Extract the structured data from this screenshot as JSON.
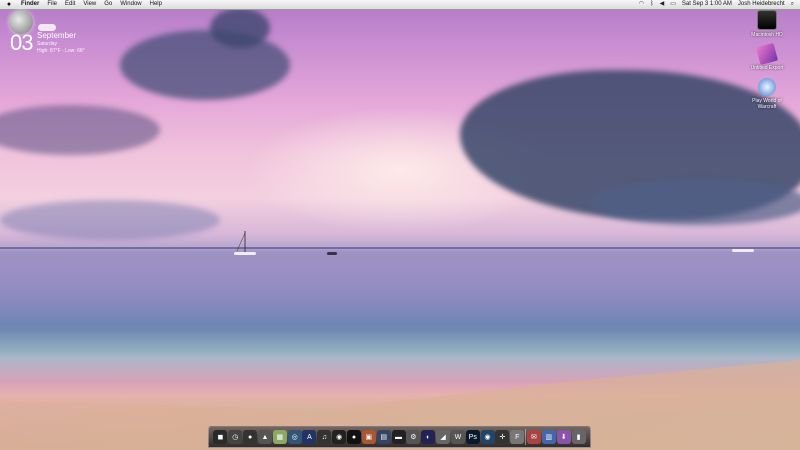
{
  "menubar": {
    "apple_icon": "apple-icon",
    "items": [
      {
        "label": "Finder",
        "bold": true
      },
      {
        "label": "File"
      },
      {
        "label": "Edit"
      },
      {
        "label": "View"
      },
      {
        "label": "Go"
      },
      {
        "label": "Window"
      },
      {
        "label": "Help"
      }
    ],
    "clock": "Sat Sep 3  1:00 AM",
    "user": "Josh Heidebrecht"
  },
  "weather": {
    "day": "03",
    "month": "September",
    "weekday": "Saturday",
    "hilo": "High: 87°F - Low: 68°"
  },
  "desktop_icons": [
    {
      "label": "Macintosh HD",
      "icon": "hard-drive-icon"
    },
    {
      "label": "Untitled Export",
      "icon": "export-icon"
    },
    {
      "label_line1": "Play World of",
      "label_line2": "Warcraft",
      "icon": "warcraft-icon"
    }
  ],
  "dock": {
    "items": [
      {
        "name": "finder-icon",
        "color": "#2a2a2a",
        "glyph": "◼"
      },
      {
        "name": "clock-icon",
        "color": "#444",
        "glyph": "◷"
      },
      {
        "name": "activity-icon",
        "color": "#333",
        "glyph": "●"
      },
      {
        "name": "spaceship-icon",
        "color": "#555",
        "glyph": "▲"
      },
      {
        "name": "photos-icon",
        "color": "#8a6",
        "glyph": "▦"
      },
      {
        "name": "safari-icon",
        "color": "#357",
        "glyph": "◎"
      },
      {
        "name": "app-store-icon",
        "color": "#236",
        "glyph": "A"
      },
      {
        "name": "itunes-icon",
        "color": "#333",
        "glyph": "♫"
      },
      {
        "name": "camera-icon",
        "color": "#222",
        "glyph": "◉"
      },
      {
        "name": "orb-icon",
        "color": "#111",
        "glyph": "●"
      },
      {
        "name": "preview-icon",
        "color": "#a53",
        "glyph": "▣"
      },
      {
        "name": "dictionary-icon",
        "color": "#346",
        "glyph": "▤"
      },
      {
        "name": "terminal-icon",
        "color": "#222",
        "glyph": "▬"
      },
      {
        "name": "system-prefs-icon",
        "color": "#555",
        "glyph": "⚙"
      },
      {
        "name": "chrome-icon",
        "color": "#225",
        "glyph": "◐"
      },
      {
        "name": "pages-icon",
        "color": "#666",
        "glyph": "◢"
      },
      {
        "name": "wordpress-icon",
        "color": "#555",
        "glyph": "W"
      },
      {
        "name": "photoshop-icon",
        "color": "#0b1a2a",
        "glyph": "Ps"
      },
      {
        "name": "disc-icon",
        "color": "#246",
        "glyph": "◉"
      },
      {
        "name": "crosshair-icon",
        "color": "#333",
        "glyph": "✛"
      },
      {
        "name": "font-book-icon",
        "color": "#777",
        "glyph": "F"
      },
      {
        "name": "mail-icon",
        "color": "#a44",
        "glyph": "✉"
      },
      {
        "name": "documents-icon",
        "color": "#46a",
        "glyph": "▥"
      },
      {
        "name": "downloads-icon",
        "color": "#85a",
        "glyph": "⬇"
      },
      {
        "name": "trash-icon",
        "color": "#666",
        "glyph": "▮"
      }
    ]
  }
}
